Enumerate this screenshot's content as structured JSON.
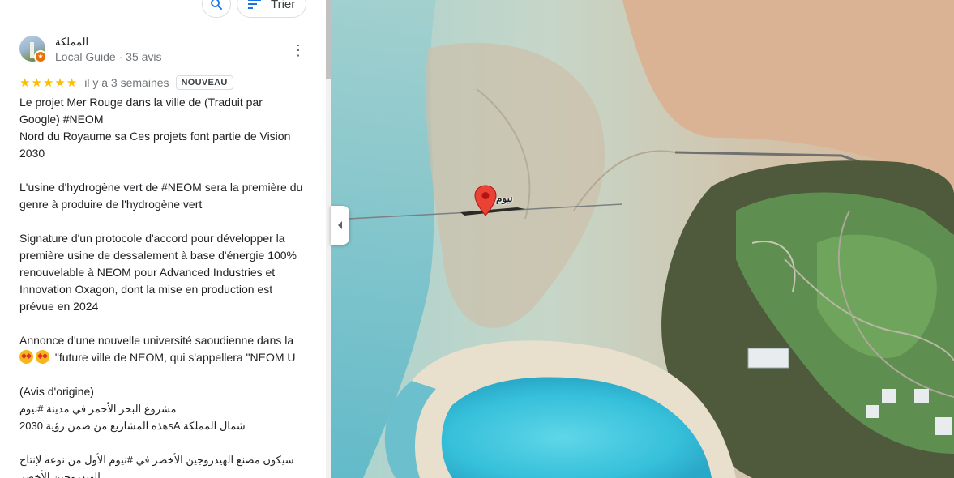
{
  "toolbar": {
    "search_icon": "search-icon",
    "sort_icon": "sort-icon",
    "sort_label": "Trier"
  },
  "review": {
    "reviewer_name": "المملكة",
    "reviewer_meta": "Local Guide · 35 avis",
    "badge_icon": "local-guide-star-icon",
    "rating": 5,
    "stars": "★★★★★",
    "time": "il y a 3 semaines",
    "new_badge": "NOUVEAU",
    "lines": [
      "Le projet Mer Rouge dans la ville de (Traduit par Google) #NEOM",
      "Nord du Royaume sa Ces projets font partie de Vision 2030",
      "",
      "L'usine d'hydrogène vert de #NEOM sera la première du genre à produire de l'hydrogène vert",
      "",
      "Signature d'un protocole d'accord pour développer la première usine de dessalement à base d'énergie 100% renouvelable à NEOM pour Advanced Industries et Innovation Oxagon, dont la mise en production est prévue en 2024",
      "",
      "Annonce d'une nouvelle université saoudienne dans la",
      "\"future ville de NEOM, qui s'appellera \"NEOM U",
      "",
      "(Avis d'origine)"
    ],
    "original_lines": [
      "مشروع البحر الأحمر في مدينة #نيوم",
      "شمال المملكة sAهذه المشاريع من ضمن رؤية 2030",
      "",
      "سيكون مصنع الهيدروجين الأخضر في #نيوم الأول من نوعه لإنتاج الهيدروجين الأخضر"
    ]
  },
  "map": {
    "pin_label": "نيوم",
    "pin_color": "#ea4335",
    "collapse_icon": "collapse-arrow-icon"
  },
  "colors": {
    "star": "#fbbc04",
    "lagoon": "#3ec4dc",
    "sand": "#d8b898",
    "golf_green": "#5f8f50"
  }
}
